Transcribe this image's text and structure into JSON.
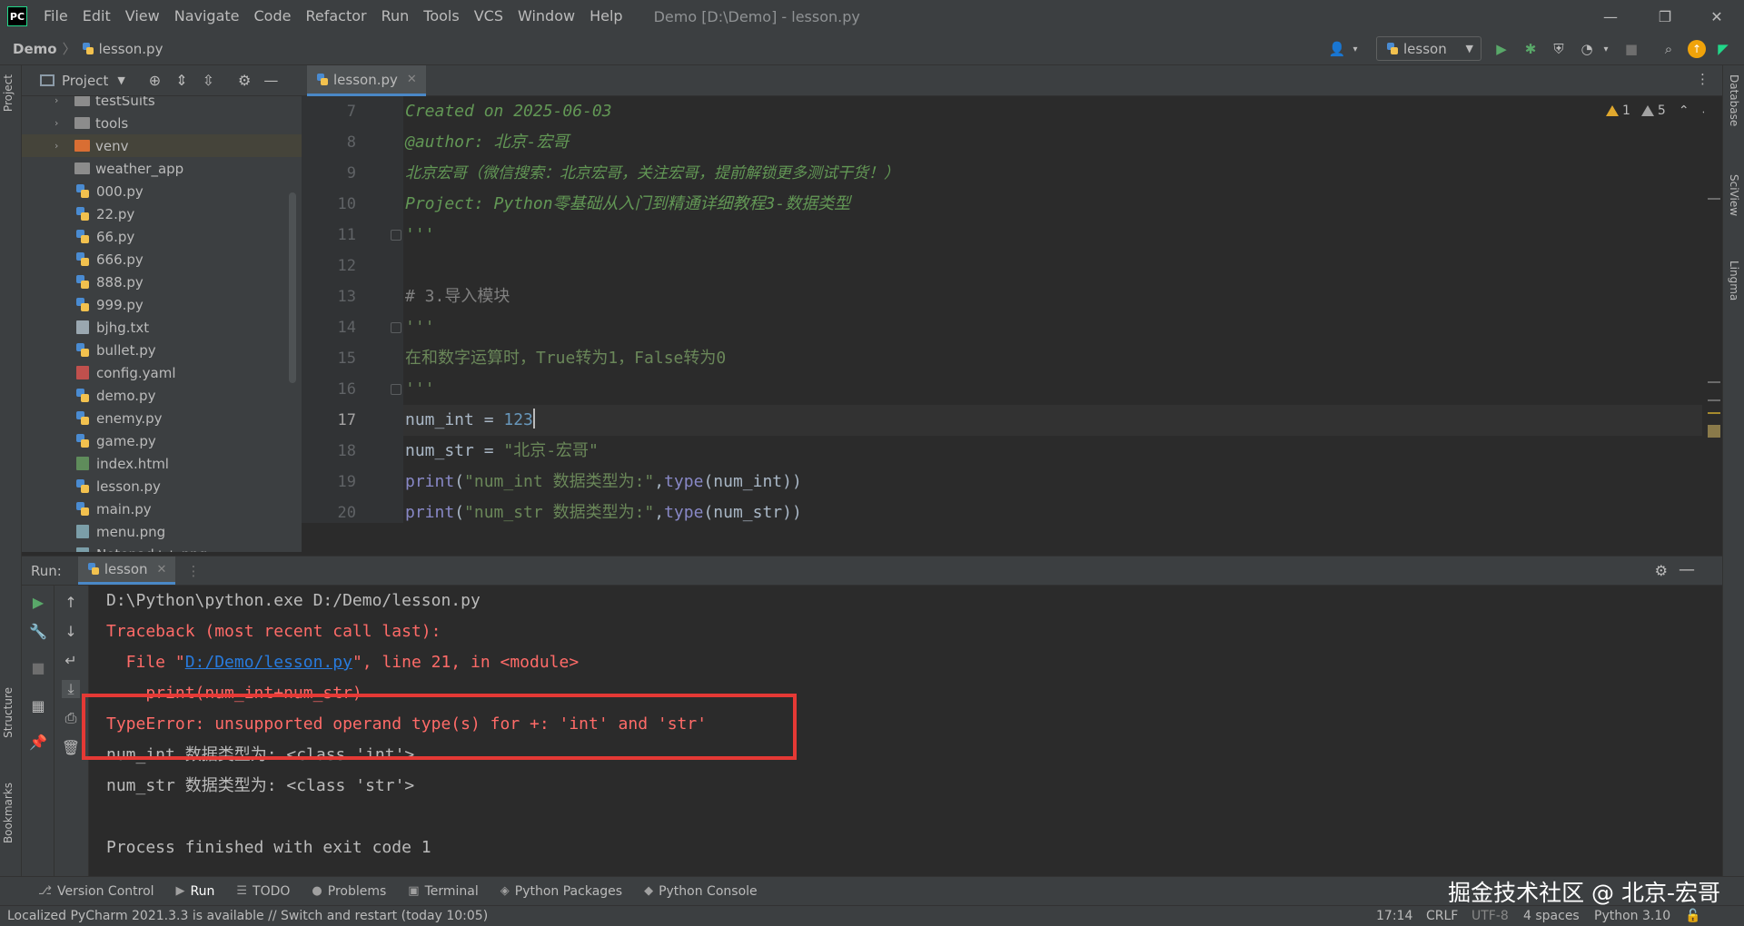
{
  "app": {
    "logo_text": "PC",
    "window_title": "Demo [D:\\Demo] - lesson.py",
    "menu": [
      "File",
      "Edit",
      "View",
      "Navigate",
      "Code",
      "Refactor",
      "Run",
      "Tools",
      "VCS",
      "Window",
      "Help"
    ]
  },
  "navbar": {
    "root": "Demo",
    "file": "lesson.py",
    "run_config": "lesson"
  },
  "left_strip": {
    "project": "Project",
    "structure": "Structure",
    "bookmarks": "Bookmarks"
  },
  "right_strip": {
    "database": "Database",
    "sciview": "SciView",
    "lingma": "Lingma"
  },
  "project": {
    "title": "Project",
    "tree": [
      {
        "name": "testSuits",
        "kind": "folder",
        "expandable": true
      },
      {
        "name": "tools",
        "kind": "folder",
        "expandable": true
      },
      {
        "name": "venv",
        "kind": "folder-orange",
        "expandable": true
      },
      {
        "name": "weather_app",
        "kind": "folder",
        "expandable": false
      },
      {
        "name": "000.py",
        "kind": "py"
      },
      {
        "name": "22.py",
        "kind": "py"
      },
      {
        "name": "66.py",
        "kind": "py"
      },
      {
        "name": "666.py",
        "kind": "py"
      },
      {
        "name": "888.py",
        "kind": "py"
      },
      {
        "name": "999.py",
        "kind": "py"
      },
      {
        "name": "bjhg.txt",
        "kind": "txt"
      },
      {
        "name": "bullet.py",
        "kind": "py"
      },
      {
        "name": "config.yaml",
        "kind": "yaml"
      },
      {
        "name": "demo.py",
        "kind": "py"
      },
      {
        "name": "enemy.py",
        "kind": "py"
      },
      {
        "name": "game.py",
        "kind": "py"
      },
      {
        "name": "index.html",
        "kind": "html"
      },
      {
        "name": "lesson.py",
        "kind": "py"
      },
      {
        "name": "main.py",
        "kind": "py"
      },
      {
        "name": "menu.png",
        "kind": "png"
      },
      {
        "name": "Notepad++.png",
        "kind": "png"
      }
    ]
  },
  "editor": {
    "tab": "lesson.py",
    "warnings": "1",
    "weak_warnings": "5",
    "current_line": 17,
    "lines": [
      {
        "num": "7",
        "parts": [
          {
            "t": "Created on 2025-06-03",
            "c": "c-doc"
          }
        ]
      },
      {
        "num": "8",
        "parts": [
          {
            "t": "@author: 北京-宏哥",
            "c": "c-doc"
          }
        ]
      },
      {
        "num": "9",
        "parts": [
          {
            "t": "北京宏哥（微信搜索：北京宏哥，关注宏哥，提前解锁更多测试干货！）",
            "c": "c-docz"
          }
        ]
      },
      {
        "num": "10",
        "parts": [
          {
            "t": "Project: Python零基础从入门到精通详细教程3-数据类型",
            "c": "c-doc"
          }
        ]
      },
      {
        "num": "11",
        "parts": [
          {
            "t": "'''",
            "c": "c-doc"
          }
        ]
      },
      {
        "num": "12",
        "parts": []
      },
      {
        "num": "13",
        "parts": [
          {
            "t": "# 3.导入模块",
            "c": "c-com"
          }
        ]
      },
      {
        "num": "14",
        "parts": [
          {
            "t": "'''",
            "c": "c-str"
          }
        ]
      },
      {
        "num": "15",
        "parts": [
          {
            "t": "在和数字运算时，True转为1，False转为0",
            "c": "c-str"
          }
        ]
      },
      {
        "num": "16",
        "parts": [
          {
            "t": "'''",
            "c": "c-str"
          }
        ]
      },
      {
        "num": "17",
        "parts": [
          {
            "t": "num_int = ",
            "c": "c-plain"
          },
          {
            "t": "123",
            "c": "c-num"
          }
        ]
      },
      {
        "num": "18",
        "parts": [
          {
            "t": "num_str = ",
            "c": "c-plain"
          },
          {
            "t": "\"北京-宏哥\"",
            "c": "c-str"
          }
        ]
      },
      {
        "num": "19",
        "parts": [
          {
            "t": "print",
            "c": "c-bi"
          },
          {
            "t": "(",
            "c": "c-plain"
          },
          {
            "t": "\"num_int 数据类型为:\"",
            "c": "c-str"
          },
          {
            "t": ",",
            "c": "c-plain"
          },
          {
            "t": "type",
            "c": "c-bi"
          },
          {
            "t": "(num_int))",
            "c": "c-plain"
          }
        ]
      },
      {
        "num": "20",
        "parts": [
          {
            "t": "print",
            "c": "c-bi"
          },
          {
            "t": "(",
            "c": "c-plain"
          },
          {
            "t": "\"num_str 数据类型为:\"",
            "c": "c-str"
          },
          {
            "t": ",",
            "c": "c-plain"
          },
          {
            "t": "type",
            "c": "c-bi"
          },
          {
            "t": "(num_str))",
            "c": "c-plain"
          }
        ]
      }
    ]
  },
  "run": {
    "label": "Run:",
    "tab": "lesson",
    "console": [
      [
        {
          "t": "D:\\Python\\python.exe D:/Demo/lesson.py",
          "c": "con-plain"
        }
      ],
      [
        {
          "t": "Traceback (most recent call last):",
          "c": "con-err"
        }
      ],
      [
        {
          "t": "  File \"",
          "c": "con-err"
        },
        {
          "t": "D:/Demo/lesson.py",
          "c": "con-link"
        },
        {
          "t": "\", line 21, in <module>",
          "c": "con-err"
        }
      ],
      [
        {
          "t": "    print(num_int+num_str)",
          "c": "con-err"
        }
      ],
      [
        {
          "t": "TypeError: unsupported operand type(s) for +: 'int' and 'str'",
          "c": "con-err"
        }
      ],
      [
        {
          "t": "num_int 数据类型为: <class 'int'>",
          "c": "con-plain"
        }
      ],
      [
        {
          "t": "num_str 数据类型为: <class 'str'>",
          "c": "con-plain"
        }
      ],
      [],
      [
        {
          "t": "Process finished with exit code 1",
          "c": "con-plain"
        }
      ]
    ]
  },
  "tool_tabs": [
    {
      "icon": "⎇",
      "label": "Version Control",
      "name": "version-control"
    },
    {
      "icon": "▶",
      "label": "Run",
      "name": "run",
      "active": true
    },
    {
      "icon": "☰",
      "label": "TODO",
      "name": "todo"
    },
    {
      "icon": "●",
      "label": "Problems",
      "name": "problems"
    },
    {
      "icon": "▣",
      "label": "Terminal",
      "name": "terminal"
    },
    {
      "icon": "◈",
      "label": "Python Packages",
      "name": "python-packages"
    },
    {
      "icon": "◆",
      "label": "Python Console",
      "name": "python-console"
    }
  ],
  "watermark": "掘金技术社区 @ 北京-宏哥",
  "status": {
    "message": "Localized PyCharm 2021.3.3 is available // Switch and restart (today 10:05)",
    "position": "17:14",
    "line_sep": "CRLF",
    "encoding": "UTF-8",
    "indent": "4 spaces",
    "interpreter": "Python 3.10"
  },
  "colors": {
    "error": "#ff6b68",
    "highlight_box": "#e53935",
    "accent": "#4a88c7"
  }
}
